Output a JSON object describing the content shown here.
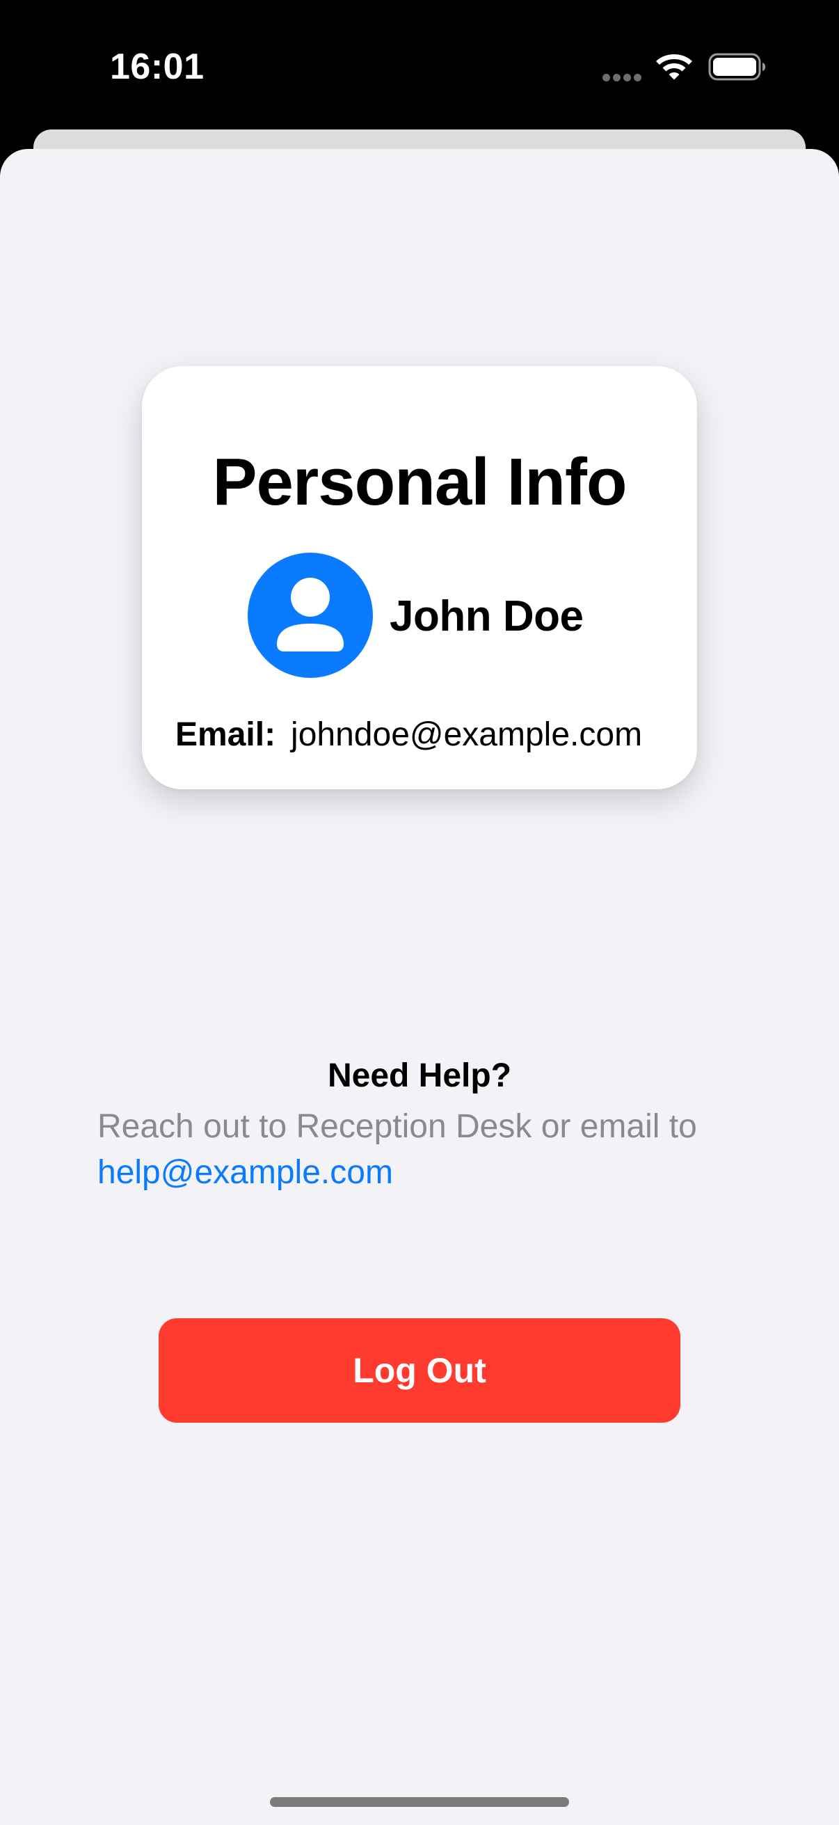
{
  "status_bar": {
    "time": "16:01",
    "icons": [
      "signal-dots-icon",
      "wifi-icon",
      "battery-icon"
    ]
  },
  "card": {
    "title": "Personal Info",
    "avatar_icon": "person-circle-icon",
    "name": "John Doe",
    "email_label": "Email:",
    "email_value": "johndoe@example.com"
  },
  "help": {
    "title": "Need Help?",
    "text": "Reach out to Reception Desk or email to",
    "link": "help@example.com"
  },
  "actions": {
    "logout_label": "Log Out"
  },
  "colors": {
    "accent": "#0a7aff",
    "destructive": "#ff3b30",
    "background": "#f2f2f7",
    "secondary_text": "#8a8a8e"
  }
}
